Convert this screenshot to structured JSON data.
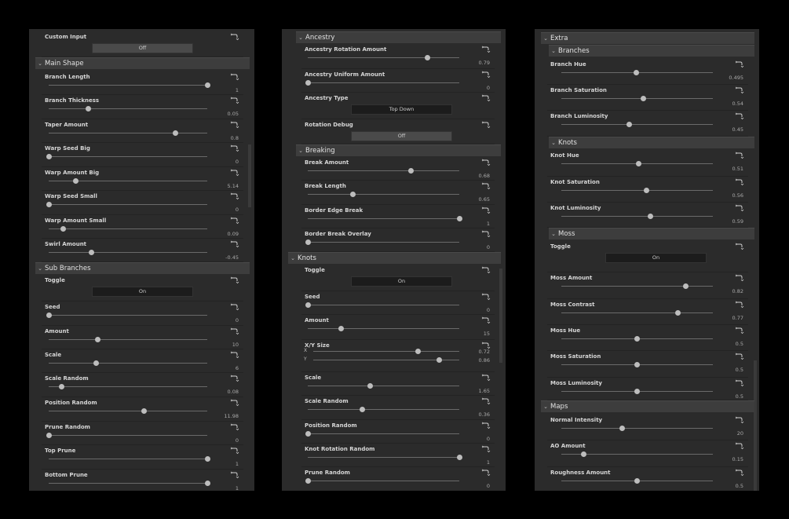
{
  "panels": [
    {
      "items": [
        {
          "type": "button",
          "label": "Custom Input",
          "button": "Off",
          "style": "off"
        },
        {
          "type": "header",
          "label": "Main Shape"
        },
        {
          "type": "slider",
          "label": "Branch Length",
          "value": "1",
          "pos": 1.0
        },
        {
          "type": "slider",
          "label": "Branch Thickness",
          "value": "0.05",
          "pos": 0.25
        },
        {
          "type": "slider",
          "label": "Taper Amount",
          "value": "0.8",
          "pos": 0.8
        },
        {
          "type": "slider",
          "label": "Warp Seed Big",
          "value": "0",
          "pos": 0.0
        },
        {
          "type": "slider",
          "label": "Warp Amount Big",
          "value": "5.14",
          "pos": 0.17
        },
        {
          "type": "slider",
          "label": "Warp Seed Small",
          "value": "0",
          "pos": 0.0
        },
        {
          "type": "slider",
          "label": "Warp Amount Small",
          "value": "0.09",
          "pos": 0.09
        },
        {
          "type": "slider",
          "label": "Swirl Amount",
          "value": "-0.45",
          "pos": 0.27
        },
        {
          "type": "header",
          "label": "Sub Branches"
        },
        {
          "type": "button",
          "label": "Toggle",
          "button": "On",
          "style": "on"
        },
        {
          "type": "slider",
          "label": "Seed",
          "value": "0",
          "pos": 0.0
        },
        {
          "type": "slider",
          "label": "Amount",
          "value": "10",
          "pos": 0.31
        },
        {
          "type": "slider",
          "label": "Scale",
          "value": "6",
          "pos": 0.3
        },
        {
          "type": "slider",
          "label": "Scale Random",
          "value": "0.08",
          "pos": 0.08
        },
        {
          "type": "slider",
          "label": "Position Random",
          "value": "11.98",
          "pos": 0.6
        },
        {
          "type": "slider",
          "label": "Prune Random",
          "value": "0",
          "pos": 0.0
        },
        {
          "type": "slider",
          "label": "Top Prune",
          "value": "1",
          "pos": 1.0
        },
        {
          "type": "slider",
          "label": "Bottom Prune",
          "value": "1",
          "pos": 1.0
        }
      ]
    },
    {
      "items": [
        {
          "type": "header",
          "label": "Ancestry",
          "sub": true
        },
        {
          "type": "slider",
          "label": "Ancestry Rotation Amount",
          "value": "0.79",
          "pos": 0.79
        },
        {
          "type": "slider",
          "label": "Ancestry Uniform Amount",
          "value": "0",
          "pos": 0.0
        },
        {
          "type": "button",
          "label": "Ancestry Type",
          "button": "Top Down",
          "style": "on"
        },
        {
          "type": "button",
          "label": "Rotation Debug",
          "button": "Off",
          "style": "off"
        },
        {
          "type": "header",
          "label": "Breaking",
          "sub": true
        },
        {
          "type": "slider",
          "label": "Break Amount",
          "value": "0.68",
          "pos": 0.68
        },
        {
          "type": "slider",
          "label": "Break Length",
          "value": "0.65",
          "pos": 0.3
        },
        {
          "type": "slider",
          "label": "Border Edge Break",
          "value": "1",
          "pos": 1.0
        },
        {
          "type": "slider",
          "label": "Border Break Overlay",
          "value": "0",
          "pos": 0.0
        },
        {
          "type": "header",
          "label": "Knots"
        },
        {
          "type": "button",
          "label": "Toggle",
          "button": "On",
          "style": "on"
        },
        {
          "type": "slider",
          "label": "Seed",
          "value": "0",
          "pos": 0.0
        },
        {
          "type": "slider",
          "label": "Amount",
          "value": "15",
          "pos": 0.22
        },
        {
          "type": "xy",
          "label": "X/Y Size",
          "x": "0.72",
          "y": "0.86",
          "xpos": 0.72,
          "ypos": 0.86
        },
        {
          "type": "slider",
          "label": "Scale",
          "value": "1.65",
          "pos": 0.41
        },
        {
          "type": "slider",
          "label": "Scale Random",
          "value": "0.36",
          "pos": 0.36
        },
        {
          "type": "slider",
          "label": "Position Random",
          "value": "0",
          "pos": 0.0
        },
        {
          "type": "slider",
          "label": "Knot Rotation Random",
          "value": "1",
          "pos": 1.0
        },
        {
          "type": "slider",
          "label": "Prune Random",
          "value": "0",
          "pos": 0.0
        }
      ]
    },
    {
      "items": [
        {
          "type": "header",
          "label": "Extra"
        },
        {
          "type": "header",
          "label": "Branches",
          "sub": true
        },
        {
          "type": "slider",
          "label": "Branch Hue",
          "value": "0.495",
          "pos": 0.495
        },
        {
          "type": "slider",
          "label": "Branch Saturation",
          "value": "0.54",
          "pos": 0.54
        },
        {
          "type": "slider",
          "label": "Branch Luminosity",
          "value": "0.45",
          "pos": 0.45
        },
        {
          "type": "header",
          "label": "Knots",
          "sub": true
        },
        {
          "type": "slider",
          "label": "Knot Hue",
          "value": "0.51",
          "pos": 0.51
        },
        {
          "type": "slider",
          "label": "Knot Saturation",
          "value": "0.56",
          "pos": 0.56
        },
        {
          "type": "slider",
          "label": "Knot Luminosity",
          "value": "0.59",
          "pos": 0.59
        },
        {
          "type": "header",
          "label": "Moss",
          "sub": true
        },
        {
          "type": "button",
          "label": "Toggle",
          "button": "On",
          "style": "on"
        },
        {
          "type": "slider",
          "label": "Moss Amount",
          "value": "0.82",
          "pos": 0.82
        },
        {
          "type": "slider",
          "label": "Moss Contrast",
          "value": "0.77",
          "pos": 0.77
        },
        {
          "type": "slider",
          "label": "Moss Hue",
          "value": "0.5",
          "pos": 0.5
        },
        {
          "type": "slider",
          "label": "Moss Saturation",
          "value": "0.5",
          "pos": 0.5
        },
        {
          "type": "slider",
          "label": "Moss Luminosity",
          "value": "0.5",
          "pos": 0.5
        },
        {
          "type": "header",
          "label": "Maps"
        },
        {
          "type": "slider",
          "label": "Normal Intensity",
          "value": "20",
          "pos": 0.4
        },
        {
          "type": "slider",
          "label": "AO Amount",
          "value": "0.15",
          "pos": 0.15
        },
        {
          "type": "slider",
          "label": "Roughness Amount",
          "value": "0.5",
          "pos": 0.5
        }
      ]
    }
  ]
}
